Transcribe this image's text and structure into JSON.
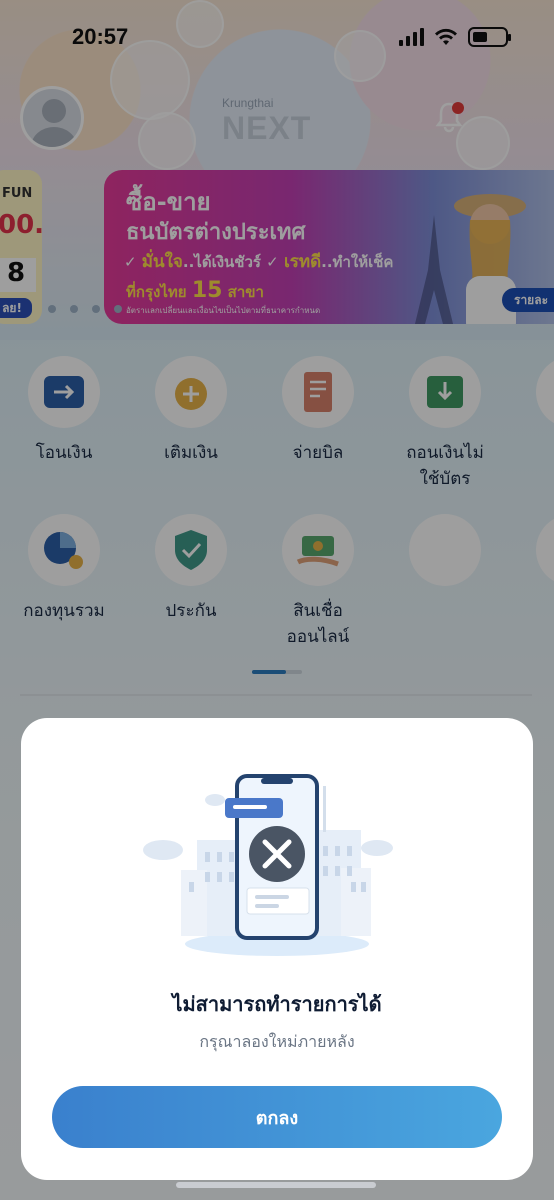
{
  "status_bar": {
    "time": "20:57"
  },
  "header": {
    "brand_small": "Krungthai",
    "brand_big": "NEXT"
  },
  "banner_left": {
    "line1": "FUN",
    "line2": "00.-",
    "line3": "8",
    "line4": "ลย!"
  },
  "banner": {
    "title_line1": "ซื้อ-ขาย",
    "title_line2": "ธนบัตรต่างประเทศ",
    "check1_bold": "มั่นใจ",
    "check1_rest": "..ได้เงินชัวร์",
    "check2_bold": "เรทดี",
    "check2_rest": "..ทำให้เช็ค",
    "branch_prefix": "ที่กรุงไทย",
    "branch_number": "15",
    "branch_suffix": "สาขา",
    "fineprint": "อัตราแลกเปลี่ยนและเงื่อนไขเป็นไปตามที่ธนาคารกำหนด",
    "cta": "รายละ"
  },
  "menu": {
    "row1": [
      {
        "label": "โอนเงิน",
        "icon": "transfer-icon"
      },
      {
        "label": "เติมเงิน",
        "icon": "topup-icon"
      },
      {
        "label": "จ่ายบิล",
        "icon": "bill-icon"
      },
      {
        "label": "ถอนเงินไม่\nใช้บัตร",
        "icon": "cardless-withdraw-icon"
      }
    ],
    "row2": [
      {
        "label": "กองทุนรวม",
        "icon": "mutual-fund-icon"
      },
      {
        "label": "ประกัน",
        "icon": "insurance-icon"
      },
      {
        "label": "สินเชื่อ\nออนไลน์",
        "icon": "online-loan-icon"
      }
    ]
  },
  "modal": {
    "title": "ไม่สามารถทำรายการได้",
    "subtitle": "กรุณาลองใหม่ภายหลัง",
    "button": "ตกลง"
  },
  "colors": {
    "primary_button_start": "#3a80cd",
    "primary_button_end": "#4aa6df",
    "error_circle": "#4a5564",
    "banner_pink": "#e63a9a"
  }
}
